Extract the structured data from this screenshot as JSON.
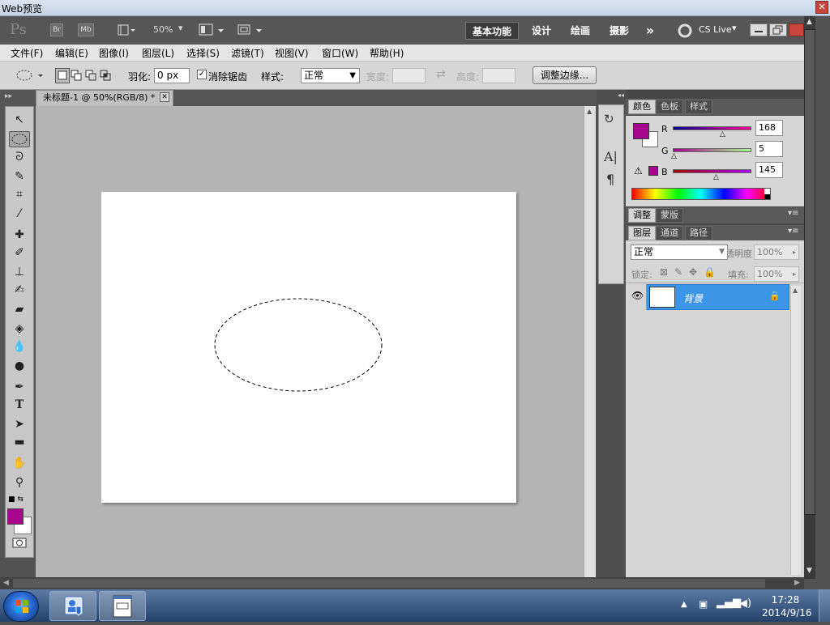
{
  "window": {
    "title": "Web预览",
    "close_label": "✕"
  },
  "appbar": {
    "logo": "Ps",
    "br_label": "Br",
    "mb_label": "Mb",
    "zoom": "50%",
    "workspaces": [
      "基本功能",
      "设计",
      "绘画",
      "摄影"
    ],
    "more": "»",
    "cs_live": "CS Live"
  },
  "menu": [
    "文件(F)",
    "编辑(E)",
    "图像(I)",
    "图层(L)",
    "选择(S)",
    "滤镜(T)",
    "视图(V)",
    "窗口(W)",
    "帮助(H)"
  ],
  "options": {
    "feather_label": "羽化:",
    "feather_value": "0 px",
    "antialias_label": "消除锯齿",
    "antialias_checked": true,
    "style_label": "样式:",
    "style_value": "正常",
    "width_label": "宽度:",
    "height_label": "高度:",
    "refine_button": "调整边缘..."
  },
  "document": {
    "tab_title": "未标题-1 @ 50%(RGB/8) *"
  },
  "colors": {
    "foreground": "#a8058f",
    "background": "#ffffff",
    "accent": "#3d95e8"
  },
  "color_panel": {
    "tabs": [
      "颜色",
      "色板",
      "样式"
    ],
    "channels": [
      {
        "name": "R",
        "value": "168"
      },
      {
        "name": "G",
        "value": "5"
      },
      {
        "name": "B",
        "value": "145"
      }
    ]
  },
  "adjust_panel": {
    "tabs": [
      "调整",
      "蒙版"
    ]
  },
  "layers_panel": {
    "tabs": [
      "图层",
      "通道",
      "路径"
    ],
    "blend_mode": "正常",
    "opacity_label": "不透明度:",
    "opacity_value": "100%",
    "lock_label": "锁定:",
    "fill_label": "填充:",
    "fill_value": "100%",
    "layers": [
      {
        "name": "背景",
        "locked": true,
        "visible": true
      }
    ]
  },
  "taskbar": {
    "time": "17:28",
    "date": "2014/9/16"
  }
}
